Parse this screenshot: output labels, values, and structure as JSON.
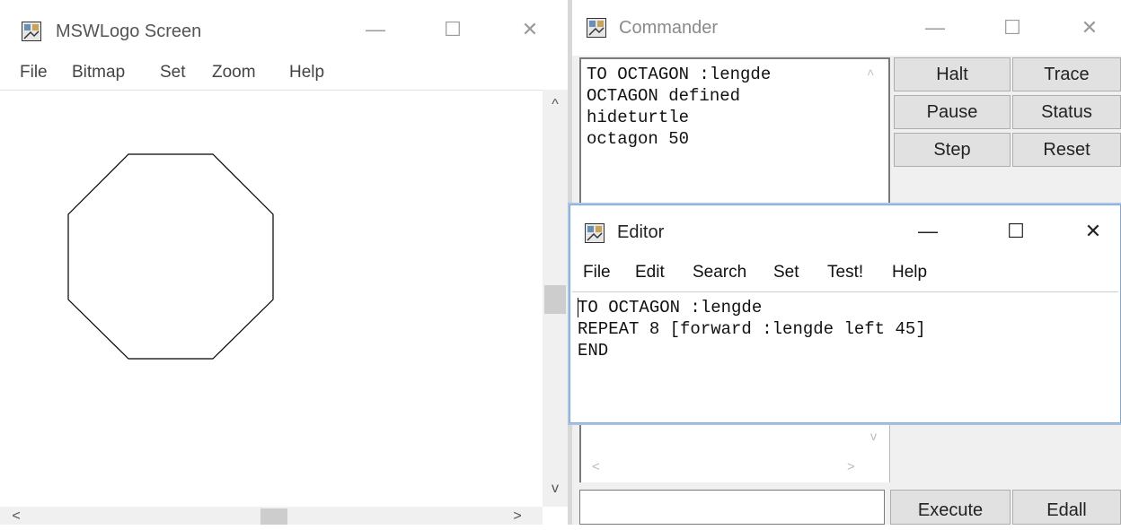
{
  "screen_window": {
    "title": "MSWLogo Screen",
    "controls": {
      "minimize": "—",
      "maximize": "☐",
      "close": "✕"
    },
    "menu": [
      "File",
      "Bitmap",
      "Set",
      "Zoom",
      "Help"
    ],
    "scroll_arrows": {
      "up": "^",
      "down": "v",
      "left": "<",
      "right": ">"
    }
  },
  "commander": {
    "title": "Commander",
    "controls": {
      "minimize": "—",
      "maximize": "☐",
      "close": "✕"
    },
    "output_lines": [
      "TO OCTAGON :lengde",
      "OCTAGON defined",
      "hideturtle",
      "octagon 50"
    ],
    "buttons": {
      "halt": "Halt",
      "trace": "Trace",
      "pause": "Pause",
      "status": "Status",
      "step": "Step",
      "reset": "Reset",
      "execute": "Execute",
      "edall": "Edall"
    },
    "input_value": ""
  },
  "editor": {
    "title": "Editor",
    "controls": {
      "minimize": "—",
      "maximize": "☐",
      "close": "✕"
    },
    "menu": [
      "File",
      "Edit",
      "Search",
      "Set",
      "Test!",
      "Help"
    ],
    "lines": [
      "TO OCTAGON :lengde",
      "REPEAT 8 [forward :lengde left 45]",
      "END"
    ]
  },
  "colors": {
    "drawing_line": "#000000",
    "editor_border": "#7fa7d6"
  }
}
